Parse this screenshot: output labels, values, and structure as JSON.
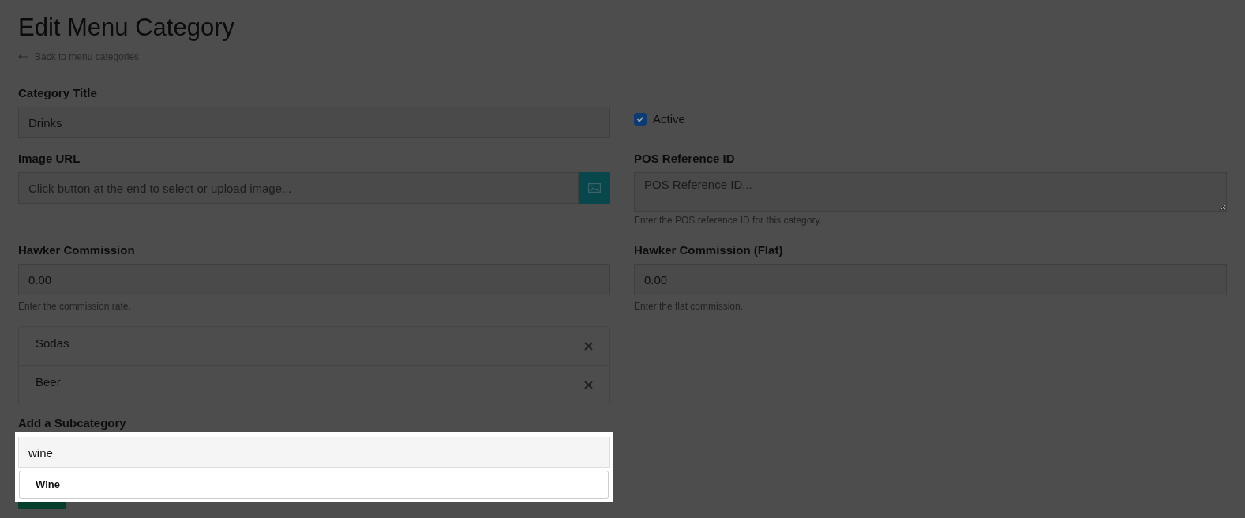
{
  "page": {
    "title": "Edit Menu Category",
    "back_link": "Back to menu categories"
  },
  "category_title": {
    "label": "Category Title",
    "value": "Drinks"
  },
  "active": {
    "label": "Active",
    "checked": true
  },
  "image_url": {
    "label": "Image URL",
    "placeholder": "Click button at the end to select or upload image..."
  },
  "pos_reference_id": {
    "label": "POS Reference ID",
    "placeholder": "POS Reference ID...",
    "help": "Enter the POS reference ID for this category."
  },
  "hawker_commission": {
    "label": "Hawker Commission",
    "value": "0.00",
    "help": "Enter the commission rate."
  },
  "hawker_commission_flat": {
    "label": "Hawker Commission (Flat)",
    "value": "0.00",
    "help": "Enter the flat commission."
  },
  "subcategories": [
    {
      "name": "Sodas"
    },
    {
      "name": "Beer"
    }
  ],
  "add_subcategory": {
    "label": "Add a Subcategory",
    "value": "wine",
    "suggestions": [
      {
        "label": "Wine"
      }
    ]
  }
}
